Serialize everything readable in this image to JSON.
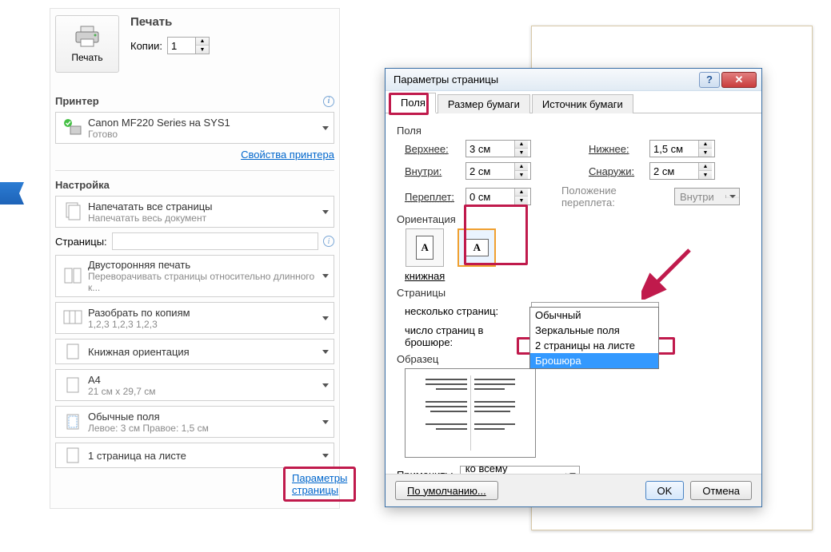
{
  "left": {
    "print_header": "Печать",
    "print_button": "Печать",
    "copies_label": "Копии:",
    "copies_value": "1",
    "printer_header": "Принтер",
    "printer_name": "Canon MF220 Series на SYS1",
    "printer_status": "Готово",
    "printer_properties": "Свойства принтера",
    "settings_header": "Настройка",
    "all_pages_title": "Напечатать все страницы",
    "all_pages_sub": "Напечатать весь документ",
    "pages_label": "Страницы:",
    "duplex_title": "Двусторонняя печать",
    "duplex_sub": "Переворачивать страницы относительно длинного к...",
    "collate_title": "Разобрать по копиям",
    "collate_sub": "1,2,3   1,2,3   1,2,3",
    "orientation_title": "Книжная ориентация",
    "paper_title": "A4",
    "paper_sub": "21 см x 29,7 см",
    "margins_title": "Обычные поля",
    "margins_sub": "Левое: 3 см   Правое: 1,5 см",
    "pages_per_sheet": "1 страница на листе",
    "page_setup_link": "Параметры страницы"
  },
  "dialog": {
    "title": "Параметры страницы",
    "tabs": [
      "Поля",
      "Размер бумаги",
      "Источник бумаги"
    ],
    "fields_group": "Поля",
    "top_label": "Верхнее:",
    "top_val": "3 см",
    "bottom_label": "Нижнее:",
    "bottom_val": "1,5 см",
    "inner_label": "Внутри:",
    "inner_val": "2 см",
    "outer_label": "Снаружи:",
    "outer_val": "2 см",
    "gutter_label": "Переплет:",
    "gutter_val": "0 см",
    "gutter_pos_label": "Положение переплета:",
    "gutter_pos_val": "Внутри",
    "orientation_group": "Ориентация",
    "orient_portrait": "книжная",
    "orient_landscape": "",
    "pages_group": "Страницы",
    "multi_label": "несколько страниц:",
    "multi_val": "Брошюра",
    "sheets_label": "число страниц в брошюре:",
    "options": [
      "Обычный",
      "Зеркальные поля",
      "2 страницы на листе",
      "Брошюра"
    ],
    "sample_group": "Образец",
    "apply_label": "Применить:",
    "apply_val": "ко всему документу",
    "default_btn": "По умолчанию...",
    "ok_btn": "OK",
    "cancel_btn": "Отмена"
  }
}
